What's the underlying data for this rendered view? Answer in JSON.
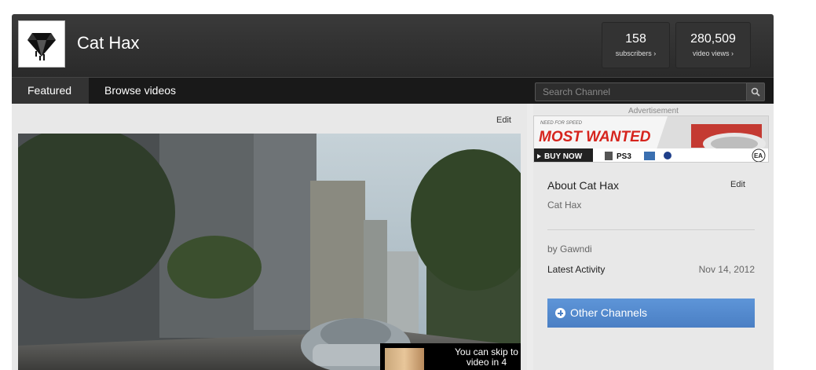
{
  "channel": {
    "name": "Cat Hax",
    "stats": [
      {
        "value": "158",
        "label": "subscribers ›"
      },
      {
        "value": "280,509",
        "label": "video views ›"
      }
    ]
  },
  "nav": {
    "tabs": [
      {
        "label": "Featured",
        "active": true
      },
      {
        "label": "Browse videos",
        "active": false
      }
    ],
    "search": {
      "placeholder": "Search Channel"
    }
  },
  "main": {
    "edit_label": "Edit",
    "video": {
      "skip_text": "You can skip to video in 4"
    }
  },
  "sidebar": {
    "ad_label": "Advertisement",
    "ad": {
      "brand": "NEED FOR SPEED",
      "title": "MOST WANTED",
      "cta": "BUY NOW",
      "platforms": [
        "PS3"
      ],
      "publisher": "EA"
    },
    "about": {
      "title": "About Cat Hax",
      "edit_label": "Edit",
      "description": "Cat Hax",
      "owner": "by Gawndi",
      "activity_label": "Latest Activity",
      "activity_date": "Nov 14, 2012"
    },
    "other_channels_label": "Other Channels"
  }
}
